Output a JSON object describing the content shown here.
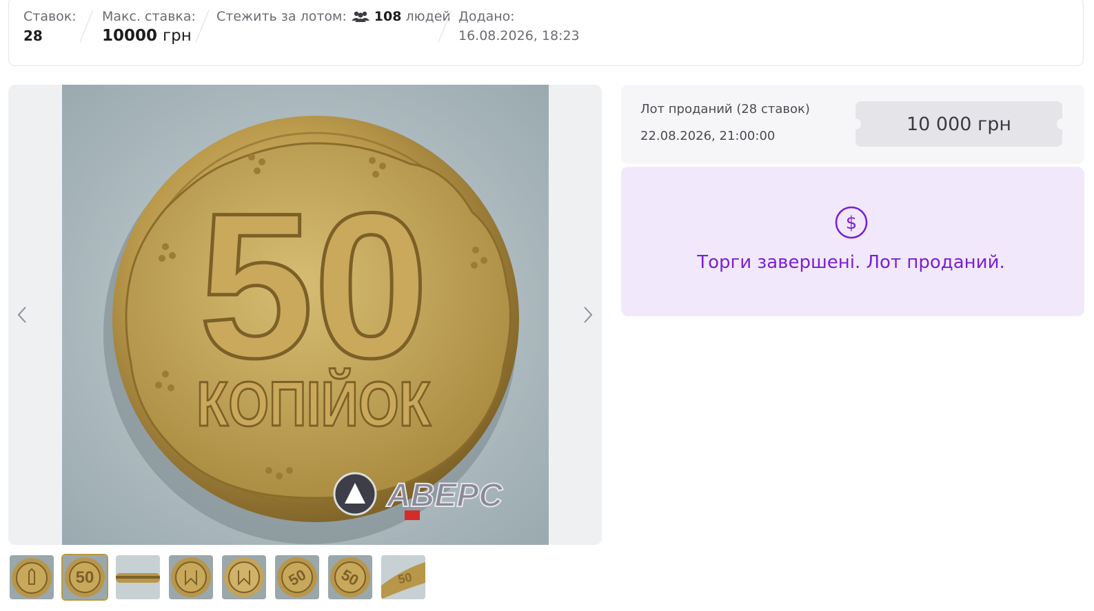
{
  "stats": {
    "bids_label": "Ставок:",
    "bids_value": "28",
    "max_bid_label": "Макс. ставка:",
    "max_bid_amount": "10000",
    "max_bid_currency": "грн",
    "watch_label": "Стежить за лотом:",
    "watch_count": "108",
    "watch_suffix": "людей",
    "added_label": "Додано:",
    "added_value": "16.08.2026, 18:23"
  },
  "gallery": {
    "coin_denomination": "50",
    "coin_word": "КОПІЙОК",
    "watermark_brand": "АВЕРС",
    "thumbnail_count": 8,
    "active_thumbnail": 2
  },
  "status": {
    "title": "Лот проданий (28 ставок)",
    "date": "22.08.2026, 21:00:00",
    "price": "10 000 грн"
  },
  "sold": {
    "message": "Торги завершені. Лот проданий."
  },
  "colors": {
    "accent_purple": "#7a1fd6",
    "sold_bg": "#f1e9fb",
    "coin_gold": "#b89a3a"
  }
}
